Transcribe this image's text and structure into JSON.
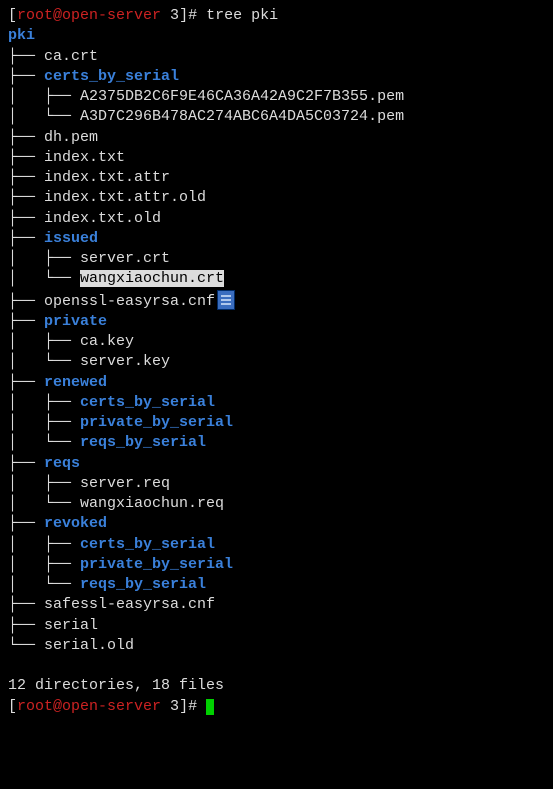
{
  "prompt1": {
    "lb": "[",
    "user_host": "root@open-server",
    "cwd": " 3",
    "rb": "]# ",
    "cmd": "tree pki"
  },
  "root": "pki",
  "n01": {
    "pre": "├── ",
    "name": "ca.crt",
    "type": "file"
  },
  "n02": {
    "pre": "├── ",
    "name": "certs_by_serial",
    "type": "dir"
  },
  "n02a": {
    "pre": "│   ├── ",
    "name": "A2375DB2C6F9E46CA36A42A9C2F7B355.pem",
    "type": "file"
  },
  "n02b": {
    "pre": "│   └── ",
    "name": "A3D7C296B478AC274ABC6A4DA5C03724.pem",
    "type": "file"
  },
  "n03": {
    "pre": "├── ",
    "name": "dh.pem",
    "type": "file"
  },
  "n04": {
    "pre": "├── ",
    "name": "index.txt",
    "type": "file"
  },
  "n05": {
    "pre": "├── ",
    "name": "index.txt.attr",
    "type": "file"
  },
  "n06": {
    "pre": "├── ",
    "name": "index.txt.attr.old",
    "type": "file"
  },
  "n07": {
    "pre": "├── ",
    "name": "index.txt.old",
    "type": "file"
  },
  "n08": {
    "pre": "├── ",
    "name": "issued",
    "type": "dir"
  },
  "n08a": {
    "pre": "│   ├── ",
    "name": "server.crt",
    "type": "file"
  },
  "n08b": {
    "pre": "│   └── ",
    "name": "wangxiaochun.crt",
    "type": "file",
    "highlight": true
  },
  "n09": {
    "pre": "├── ",
    "name": "openssl-easyrsa.cnf",
    "type": "file"
  },
  "n10": {
    "pre": "├── ",
    "name": "private",
    "type": "dir"
  },
  "n10a": {
    "pre": "│   ├── ",
    "name": "ca.key",
    "type": "file"
  },
  "n10b": {
    "pre": "│   └── ",
    "name": "server.key",
    "type": "file"
  },
  "n11": {
    "pre": "├── ",
    "name": "renewed",
    "type": "dir"
  },
  "n11a": {
    "pre": "│   ├── ",
    "name": "certs_by_serial",
    "type": "dir"
  },
  "n11b": {
    "pre": "│   ├── ",
    "name": "private_by_serial",
    "type": "dir"
  },
  "n11c": {
    "pre": "│   └── ",
    "name": "reqs_by_serial",
    "type": "dir"
  },
  "n12": {
    "pre": "├── ",
    "name": "reqs",
    "type": "dir"
  },
  "n12a": {
    "pre": "│   ├── ",
    "name": "server.req",
    "type": "file"
  },
  "n12b": {
    "pre": "│   └── ",
    "name": "wangxiaochun.req",
    "type": "file"
  },
  "n13": {
    "pre": "├── ",
    "name": "revoked",
    "type": "dir"
  },
  "n13a": {
    "pre": "│   ├── ",
    "name": "certs_by_serial",
    "type": "dir"
  },
  "n13b": {
    "pre": "│   ├── ",
    "name": "private_by_serial",
    "type": "dir"
  },
  "n13c": {
    "pre": "│   └── ",
    "name": "reqs_by_serial",
    "type": "dir"
  },
  "n14": {
    "pre": "├── ",
    "name": "safessl-easyrsa.cnf",
    "type": "file"
  },
  "n15": {
    "pre": "├── ",
    "name": "serial",
    "type": "file"
  },
  "n16": {
    "pre": "└── ",
    "name": "serial.old",
    "type": "file"
  },
  "blank": " ",
  "summary": "12 directories, 18 files",
  "prompt2": {
    "lb": "[",
    "user_host": "root@open-server",
    "cwd": " 3",
    "rb": "]# "
  }
}
